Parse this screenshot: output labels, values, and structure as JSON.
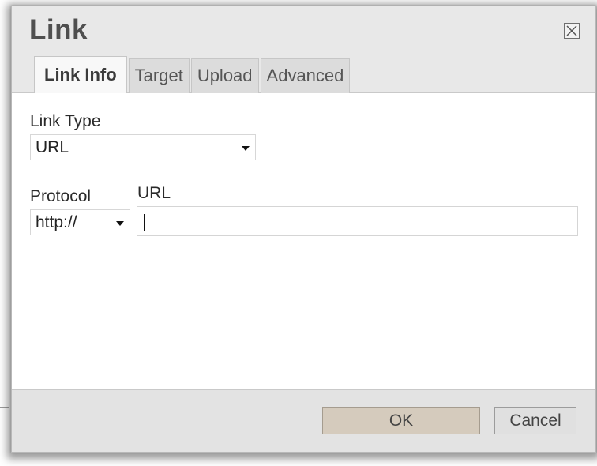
{
  "dialog": {
    "title": "Link",
    "close_icon": "close-x-icon"
  },
  "tabs": [
    {
      "label": "Link Info",
      "active": true
    },
    {
      "label": "Target",
      "active": false
    },
    {
      "label": "Upload",
      "active": false
    },
    {
      "label": "Advanced",
      "active": false
    }
  ],
  "form": {
    "link_type": {
      "label": "Link Type",
      "value": "URL"
    },
    "protocol": {
      "label": "Protocol",
      "value": "http://"
    },
    "url": {
      "label": "URL",
      "value": ""
    }
  },
  "footer": {
    "ok_label": "OK",
    "cancel_label": "Cancel"
  },
  "colors": {
    "ok_button": "#d5cbbd",
    "titlebar": "#e8e8e8",
    "title_text": "#4f4f4f"
  }
}
